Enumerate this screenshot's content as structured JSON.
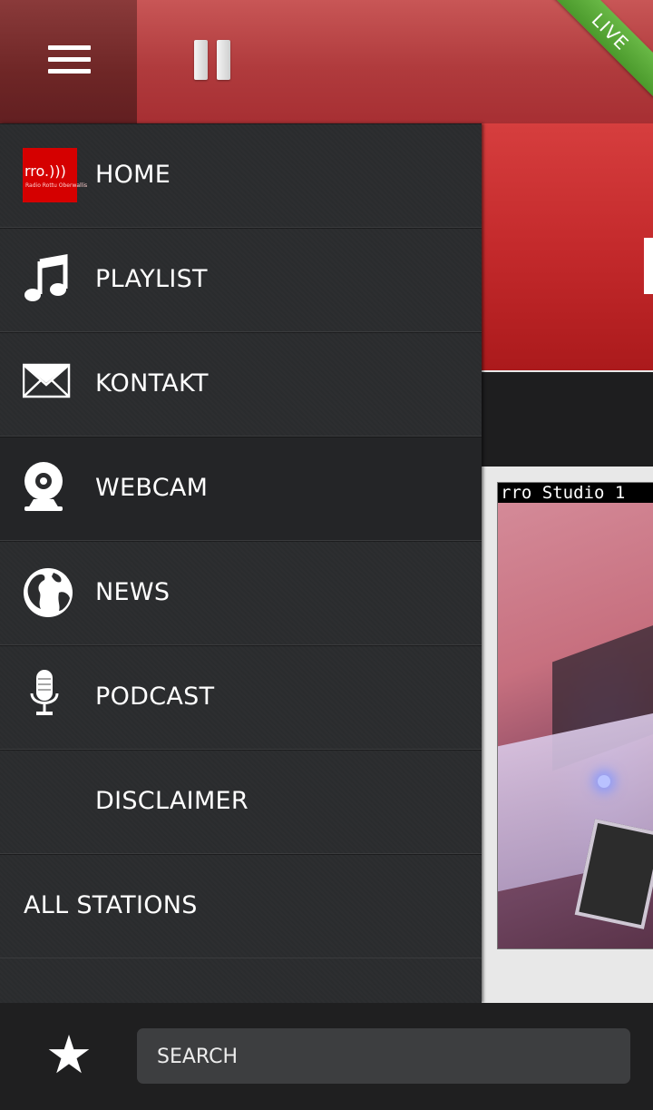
{
  "header": {
    "menu_icon": "hamburger-menu-icon",
    "pause_icon": "pause-icon",
    "live_badge": "LIVE"
  },
  "webcam_preview": {
    "caption": "rro Studio 1"
  },
  "drawer": {
    "items": [
      {
        "label": "HOME",
        "icon": "rro-logo-icon",
        "logo_text": "rro.)))",
        "logo_sub": "Radio Rottu Oberwallis"
      },
      {
        "label": "PLAYLIST",
        "icon": "music-note-icon"
      },
      {
        "label": "KONTAKT",
        "icon": "envelope-icon"
      },
      {
        "label": "WEBCAM",
        "icon": "webcam-icon",
        "active": true
      },
      {
        "label": "NEWS",
        "icon": "globe-icon"
      },
      {
        "label": "PODCAST",
        "icon": "microphone-icon"
      },
      {
        "label": "DISCLAIMER",
        "icon": null
      },
      {
        "label": "ALL STATIONS",
        "icon": null
      }
    ]
  },
  "bottom_bar": {
    "favorite_icon": "star-icon",
    "favorite_symbol": "★",
    "search_placeholder": "SEARCH"
  },
  "colors": {
    "header_red": "#b03b3d",
    "menu_button_dark_red": "#6e2626",
    "drawer_bg": "#2b2c2e",
    "live_green": "#5aa938",
    "bottom_bar_bg": "#1f1f20",
    "search_bg": "#3d3e40"
  }
}
